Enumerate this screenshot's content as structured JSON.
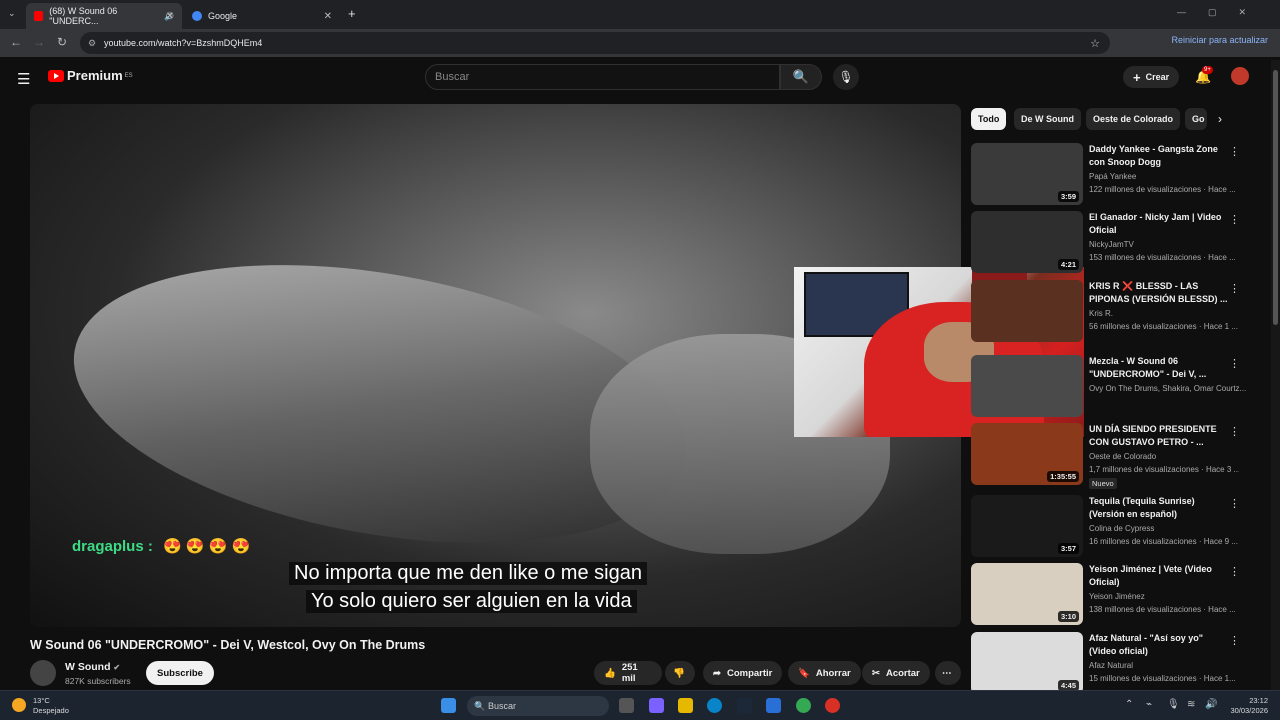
{
  "browser": {
    "tabs": [
      {
        "title": "(68) W Sound 06 \"UNDERC..."
      },
      {
        "title": "Google"
      }
    ],
    "new_tab": "+",
    "url": "youtube.com/watch?v=BzshmDQHEm4",
    "restart_label": "Reiniciar para actualizar"
  },
  "header": {
    "logo": "Premium",
    "logo_region": "ES",
    "search_placeholder": "Buscar",
    "create_label": "Crear",
    "notifications": "9+"
  },
  "video": {
    "chat_user": "dragaplus",
    "chat_message": "😍 😍 😍 😍",
    "subtitle_line1": "No importa que me den like o me sigan",
    "subtitle_line2": "Yo solo quiero ser alguien en la vida",
    "title": "W Sound 06 \"UNDERCROMO\" - Dei V, Westcol, Ovy On The Drums",
    "channel": "W Sound",
    "subscribers": "827K subscribers",
    "subscribe_label": "Subscribe",
    "likes": "251 mil",
    "share_label": "Compartir",
    "save_label": "Ahorrar",
    "clip_label": "Acortar"
  },
  "sidebar": {
    "chips": [
      "Todo",
      "De W Sound",
      "Oeste de Colorado",
      "Go"
    ],
    "items": [
      {
        "title": "Daddy Yankee - Gangsta Zone con Snoop Dogg",
        "channel": "Papá Yankee",
        "meta": "122 millones de visualizaciones · Hace ...",
        "duration": "3:59",
        "thumb": "#3a3a3a"
      },
      {
        "title": "El Ganador - Nicky Jam | Video Oficial",
        "channel": "NickyJamTV",
        "meta": "153 millones de visualizaciones · Hace ...",
        "duration": "4:21",
        "thumb": "#2e2e2e"
      },
      {
        "title": "KRIS R ❌ BLESSD - LAS PIPONAS (VERSIÓN BLESSD) ...",
        "channel": "Kris R.",
        "meta": "56 millones de visualizaciones · Hace 1 ...",
        "duration": "",
        "thumb": "#5a3020"
      },
      {
        "title": "Mezcla - W Sound 06 \"UNDERCROMO\" - Dei V, ...",
        "channel": "Ovy On The Drums, Shakira, Omar Courtz...",
        "meta": "",
        "duration": "",
        "thumb": "#4a4a4a"
      },
      {
        "title": "UN DÍA SIENDO PRESIDENTE CON GUSTAVO PETRO - ...",
        "channel": "Oeste de Colorado",
        "meta": "1,7 millones de visualizaciones · Hace 3 ...",
        "duration": "1:35:55",
        "badge": "Nuevo",
        "thumb": "#8a3a1a"
      },
      {
        "title": "Tequila (Tequila Sunrise) (Versión en español)",
        "channel": "Colina de Cypress",
        "meta": "16 millones de visualizaciones · Hace 9 ...",
        "duration": "3:57",
        "thumb": "#1a1a1a"
      },
      {
        "title": "Yeison Jiménez | Vete (Video Oficial)",
        "channel": "Yeison Jiménez",
        "meta": "138 millones de visualizaciones · Hace ...",
        "duration": "3:10",
        "thumb": "#d8cfc0"
      },
      {
        "title": "Afaz Natural - \"Así soy yo\" (Video oficial)",
        "channel": "Afaz Natural",
        "meta": "15 millones de visualizaciones · Hace 1...",
        "duration": "4:45",
        "thumb": "#dcdcdc"
      }
    ]
  },
  "taskbar": {
    "temp": "13°C",
    "weather": "Despejado",
    "search_placeholder": "Buscar",
    "time": "23:12",
    "date": "30/03/2026"
  }
}
